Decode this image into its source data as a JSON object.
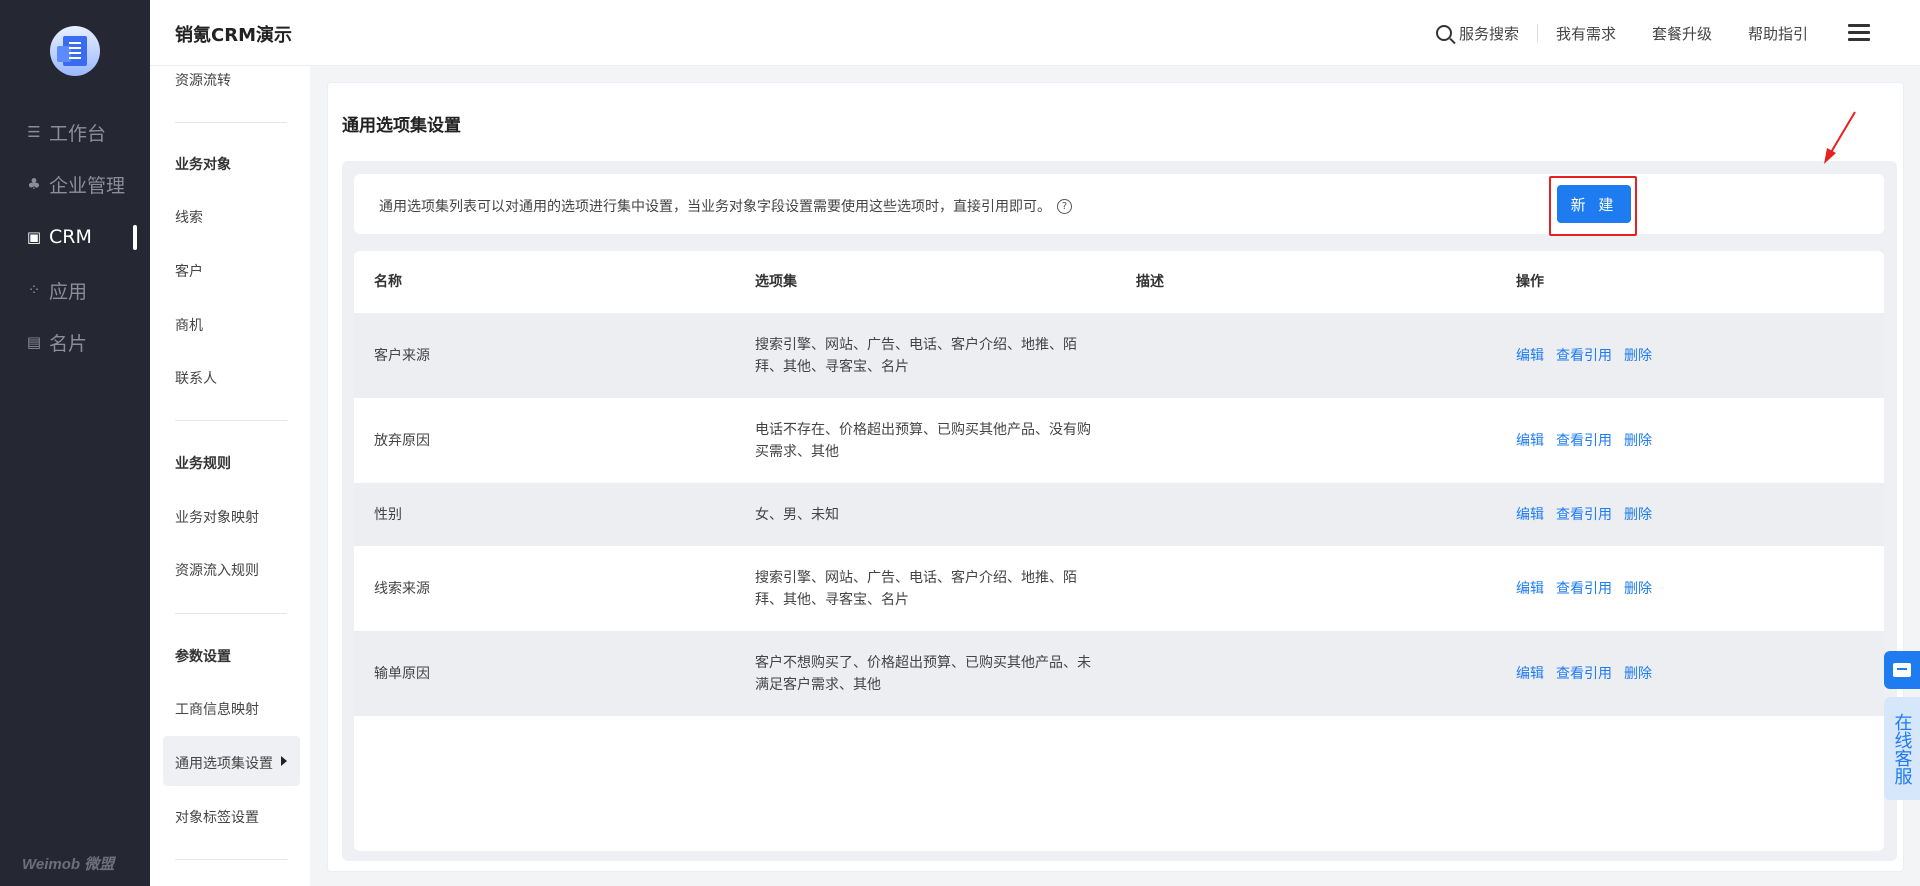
{
  "app": {
    "title": "销氪CRM演示"
  },
  "topbar": {
    "search_label": "服务搜索",
    "links": [
      "我有需求",
      "套餐升级",
      "帮助指引"
    ]
  },
  "leftnav": {
    "items": [
      {
        "label": "工作台",
        "icon": "list-icon"
      },
      {
        "label": "企业管理",
        "icon": "org-icon"
      },
      {
        "label": "CRM",
        "icon": "crm-icon",
        "active": true
      },
      {
        "label": "应用",
        "icon": "apps-icon"
      },
      {
        "label": "名片",
        "icon": "card-icon"
      }
    ],
    "brand": "Weimob 微盟"
  },
  "submenu": {
    "top_item": "资源流转",
    "groups": [
      {
        "heading": "业务对象",
        "items": [
          "线索",
          "客户",
          "商机",
          "联系人"
        ]
      },
      {
        "heading": "业务规则",
        "items": [
          "业务对象映射",
          "资源流入规则"
        ]
      },
      {
        "heading": "参数设置",
        "items": [
          "工商信息映射",
          "通用选项集设置",
          "对象标签设置"
        ]
      }
    ],
    "selected": "通用选项集设置"
  },
  "page": {
    "title": "通用选项集设置",
    "info": "通用选项集列表可以对通用的选项进行集中设置，当业务对象字段设置需要使用这些选项时，直接引用即可。",
    "new_button": "新 建"
  },
  "table": {
    "columns": [
      "名称",
      "选项集",
      "描述",
      "操作"
    ],
    "actions": [
      "编辑",
      "查看引用",
      "删除"
    ],
    "rows": [
      {
        "name": "客户来源",
        "options": "搜索引擎、网站、广告、电话、客户介绍、地推、陌拜、其他、寻客宝、名片",
        "desc": ""
      },
      {
        "name": "放弃原因",
        "options": "电话不存在、价格超出预算、已购买其他产品、没有购买需求、其他",
        "desc": ""
      },
      {
        "name": "性别",
        "options": "女、男、未知",
        "desc": ""
      },
      {
        "name": "线索来源",
        "options": "搜索引擎、网站、广告、电话、客户介绍、地推、陌拜、其他、寻客宝、名片",
        "desc": ""
      },
      {
        "name": "输单原因",
        "options": "客户不想购买了、价格超出预算、已购买其他产品、未满足客户需求、其他",
        "desc": ""
      }
    ]
  },
  "float": {
    "service_label": "在线客服"
  },
  "colors": {
    "accent": "#1e7cf0",
    "nav_bg": "#252833",
    "highlight": "#e8201f"
  }
}
